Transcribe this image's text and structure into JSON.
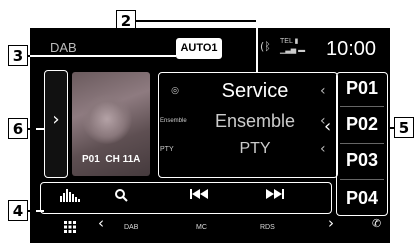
{
  "callouts": [
    "2",
    "3",
    "6",
    "4",
    "5"
  ],
  "status": {
    "source": "DAB",
    "mode": "AUTO1",
    "clock": "10:00",
    "tel": "TEL"
  },
  "station": {
    "preset_channel": "P01  CH 11A",
    "rows": [
      {
        "tag": "",
        "value": "Service"
      },
      {
        "tag": "Ensemble",
        "value": "Ensemble"
      },
      {
        "tag": "PTY",
        "value": "PTY"
      }
    ]
  },
  "presets": [
    "P01",
    "P02",
    "P03",
    "P04"
  ],
  "nav": {
    "items": [
      "DAB",
      "MC",
      "RDS"
    ]
  },
  "colors": {
    "screen": "#000000",
    "callout_border": "#000000",
    "presets_highlight": "#ffffff"
  },
  "icons": [
    "grid-icon",
    "chevron-left-icon",
    "chevron-right-icon",
    "phone-icon",
    "equalizer-icon",
    "search-icon",
    "skip-previous-icon",
    "skip-next-icon",
    "bluetooth-icon"
  ]
}
